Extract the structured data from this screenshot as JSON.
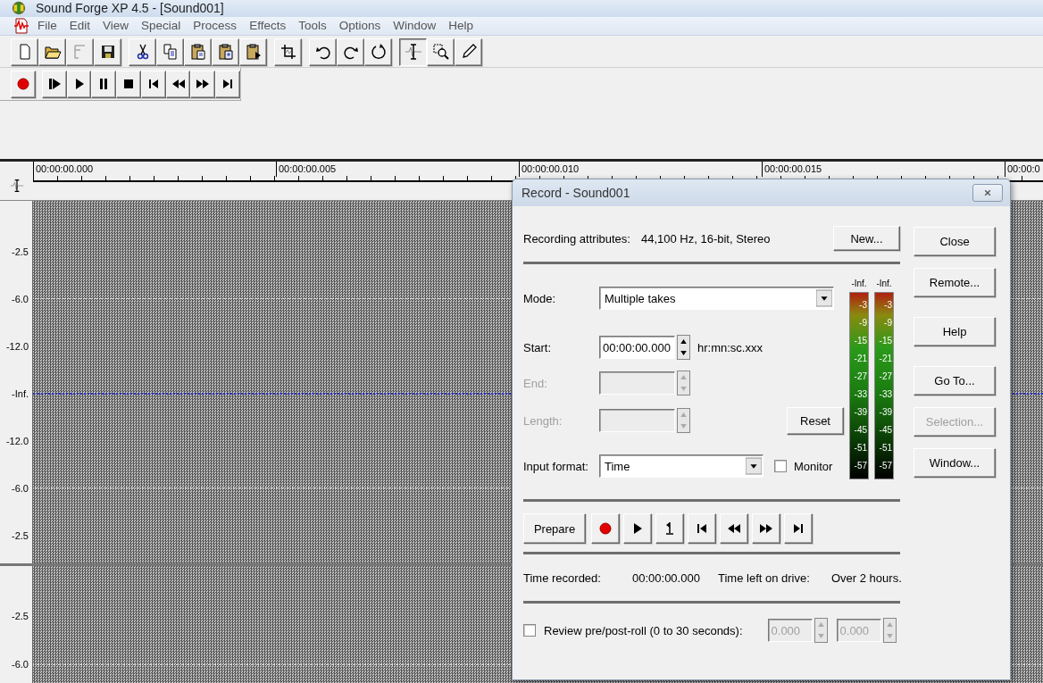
{
  "window": {
    "title": "Sound Forge XP 4.5 - [Sound001]"
  },
  "menu": [
    "File",
    "Edit",
    "View",
    "Special",
    "Process",
    "Effects",
    "Tools",
    "Options",
    "Window",
    "Help"
  ],
  "toolbar": [
    {
      "selected": false
    },
    {
      "selected": false
    },
    {
      "selected": false
    },
    {
      "selected": false
    },
    {
      "selected": false
    },
    {
      "selected": false
    },
    {
      "selected": false
    },
    {
      "selected": false
    },
    {
      "selected": false
    },
    {
      "selected": false
    },
    {
      "selected": false
    },
    {
      "selected": false
    },
    {
      "selected": false
    },
    {
      "selected": true
    },
    {
      "selected": false
    },
    {
      "selected": false
    }
  ],
  "waveform": {
    "ruler": [
      "00:00:00.000",
      "00:00:00.005",
      "00:00:00.010",
      "00:00:00.015",
      "00:00:0"
    ],
    "channels": [
      {
        "scale": [
          {
            "label": "-2.5",
            "kind": "plain"
          },
          {
            "label": "-6.0",
            "kind": "grid"
          },
          {
            "label": "-12.0",
            "kind": "plain"
          },
          {
            "label": "-Inf.",
            "kind": "center"
          },
          {
            "label": "-12.0",
            "kind": "plain"
          },
          {
            "label": "-6.0",
            "kind": "grid"
          },
          {
            "label": "-2.5",
            "kind": "plain"
          }
        ]
      },
      {
        "scale": [
          {
            "label": "-2.5",
            "kind": "plain"
          },
          {
            "label": "-6.0",
            "kind": "grid"
          }
        ]
      }
    ]
  },
  "record_dialog": {
    "title": "Record - Sound001",
    "attributes_label": "Recording attributes:",
    "attributes_value": "44,100 Hz, 16-bit, Stereo",
    "new_button": "New...",
    "mode": {
      "label": "Mode:",
      "value": "Multiple takes"
    },
    "time_fields": [
      {
        "label": "Start:",
        "value": "00:00:00.000",
        "disabled": false,
        "hint": "hr:mn:sc.xxx"
      },
      {
        "label": "End:",
        "disabled": true
      },
      {
        "label": "Length:",
        "disabled": true,
        "button": "Reset"
      }
    ],
    "input_format": {
      "label": "Input format:",
      "value": "Time"
    },
    "monitor": {
      "label": "Monitor",
      "checked": false
    },
    "meters": [
      {
        "peak": "-Inf.",
        "scale": [
          "-3",
          "-9",
          "-15",
          "-21",
          "-27",
          "-33",
          "-39",
          "-45",
          "-51",
          "-57"
        ]
      },
      {
        "peak": "-Inf.",
        "scale": [
          "-3",
          "-9",
          "-15",
          "-21",
          "-27",
          "-33",
          "-39",
          "-45",
          "-51",
          "-57"
        ]
      }
    ],
    "prepare_button": "Prepare",
    "time_recorded_label": "Time recorded:",
    "time_recorded": "00:00:00.000",
    "time_left_label": "Time left on drive:",
    "time_left": "Over 2 hours.",
    "review": {
      "label": "Review pre/post-roll (0 to 30 seconds):",
      "checked": false,
      "fields": [
        {
          "value": "0.000",
          "disabled": true
        },
        {
          "value": "0.000",
          "disabled": true
        }
      ]
    },
    "side_buttons": [
      {
        "label": "Close",
        "disabled": false
      },
      {
        "label": "Remote...",
        "disabled": false
      },
      {
        "label": "Help",
        "disabled": false
      },
      {
        "label": "Go To...",
        "disabled": false
      },
      {
        "label": "Selection...",
        "disabled": true
      },
      {
        "label": "Window...",
        "disabled": false
      }
    ]
  }
}
